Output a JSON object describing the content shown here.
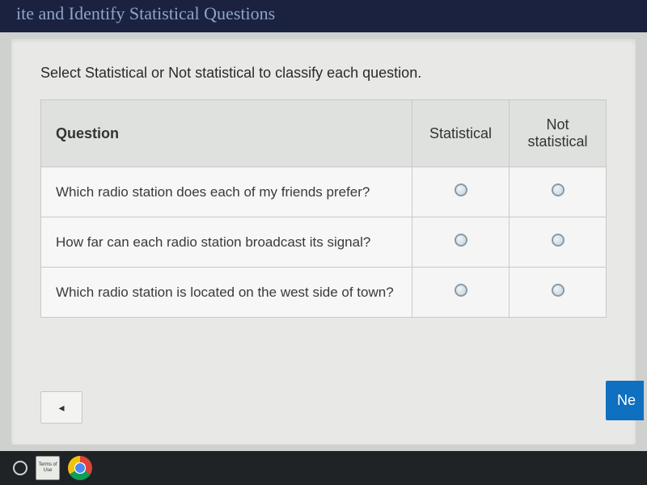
{
  "header": {
    "title_partial": "ite and Identify Statistical Questions"
  },
  "instruction": "Select Statistical or Not statistical to classify each question.",
  "table": {
    "headers": {
      "question": "Question",
      "stat": "Statistical",
      "notstat": "Not statistical"
    },
    "rows": [
      {
        "question": "Which radio station does each of my friends prefer?"
      },
      {
        "question": "How far can each radio station broadcast its signal?"
      },
      {
        "question": "Which radio station is located on the west side of town?"
      }
    ]
  },
  "nav": {
    "next": "Ne",
    "back_glyph": "◂"
  },
  "taskbar": {
    "terms_label": "Terms\nof\nUse"
  }
}
